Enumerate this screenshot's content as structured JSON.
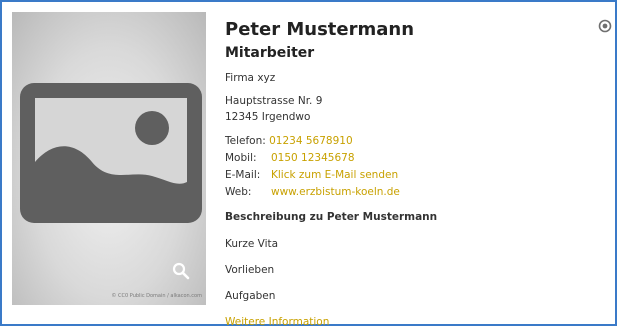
{
  "person": {
    "name": "Peter Mustermann",
    "position": "Mitarbeiter",
    "company": "Firma xyz",
    "street": "Hauptstrasse Nr. 9",
    "city": "12345 Irgendwo"
  },
  "contact": {
    "phone_label": "Telefon:",
    "phone": "01234 5678910",
    "mobile_label": "Mobil:",
    "mobile": "0150 12345678",
    "email_label": "E-Mail:",
    "email_link": "Klick zum E-Mail senden",
    "web_label": "Web:",
    "web": "www.erzbistum-koeln.de"
  },
  "description": {
    "heading": "Beschreibung zu Peter Mustermann",
    "items": [
      "Kurze Vita",
      "Vorlieben",
      "Aufgaben"
    ],
    "more_link": "Weitere Information"
  },
  "photo": {
    "credit": "© CC0 Public Domain / alkacon.com"
  },
  "icons": {
    "zoom": "magnifier-icon",
    "settings": "settings-icon"
  },
  "colors": {
    "border": "#3a7ac8",
    "link": "#c8a100"
  }
}
